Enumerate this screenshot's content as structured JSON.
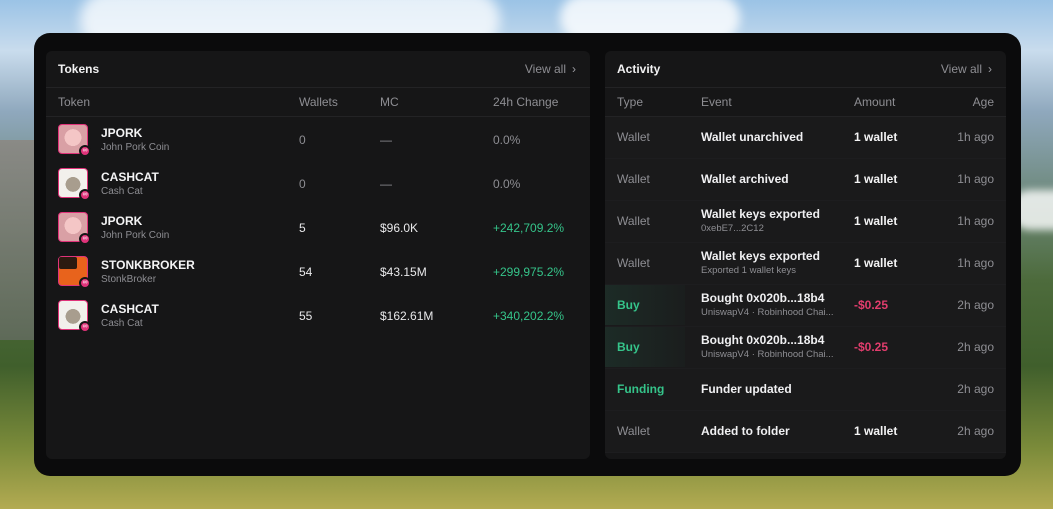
{
  "tokens": {
    "title": "Tokens",
    "view_all": "View all",
    "columns": {
      "token": "Token",
      "wallets": "Wallets",
      "mc": "MC",
      "change": "24h Change"
    },
    "rows": [
      {
        "symbol": "JPORK",
        "name": "John Pork Coin",
        "wallets": "0",
        "mc": "—",
        "change": "0.0%",
        "avatar": "pig"
      },
      {
        "symbol": "CASHCAT",
        "name": "Cash Cat",
        "wallets": "0",
        "mc": "—",
        "change": "0.0%",
        "avatar": "cat"
      },
      {
        "symbol": "JPORK",
        "name": "John Pork Coin",
        "wallets": "5",
        "mc": "$96.0K",
        "change": "+242,709.2%",
        "avatar": "pig"
      },
      {
        "symbol": "STONKBROKER",
        "name": "StonkBroker",
        "wallets": "54",
        "mc": "$43.15M",
        "change": "+299,975.2%",
        "avatar": "stonk"
      },
      {
        "symbol": "CASHCAT",
        "name": "Cash Cat",
        "wallets": "55",
        "mc": "$162.61M",
        "change": "+340,202.2%",
        "avatar": "cat"
      }
    ]
  },
  "activity": {
    "title": "Activity",
    "view_all": "View all",
    "columns": {
      "type": "Type",
      "event": "Event",
      "amount": "Amount",
      "age": "Age"
    },
    "rows": [
      {
        "type": "Wallet",
        "event": "Wallet unarchived",
        "sub": "",
        "amount": "1 wallet",
        "age": "1h ago"
      },
      {
        "type": "Wallet",
        "event": "Wallet archived",
        "sub": "",
        "amount": "1 wallet",
        "age": "1h ago"
      },
      {
        "type": "Wallet",
        "event": "Wallet keys exported",
        "sub": "0xebE7...2C12",
        "amount": "1 wallet",
        "age": "1h ago"
      },
      {
        "type": "Wallet",
        "event": "Wallet keys exported",
        "sub": "Exported 1 wallet keys",
        "amount": "1 wallet",
        "age": "1h ago"
      },
      {
        "type": "Buy",
        "event": "Bought 0x020b...18b4",
        "sub": "UniswapV4 · Robinhood Chai...",
        "amount": "-$0.25",
        "age": "2h ago"
      },
      {
        "type": "Buy",
        "event": "Bought 0x020b...18b4",
        "sub": "UniswapV4 · Robinhood Chai...",
        "amount": "-$0.25",
        "age": "2h ago"
      },
      {
        "type": "Funding",
        "event": "Funder updated",
        "sub": "",
        "amount": "",
        "age": "2h ago"
      },
      {
        "type": "Wallet",
        "event": "Added to folder",
        "sub": "",
        "amount": "1 wallet",
        "age": "2h ago"
      }
    ]
  },
  "icons": {
    "view_all": "chevron-right-icon",
    "badge": "chain-badge-icon"
  },
  "colors": {
    "positive": "#35c48a",
    "negative": "#e23d6d",
    "accent": "#e0337a"
  }
}
